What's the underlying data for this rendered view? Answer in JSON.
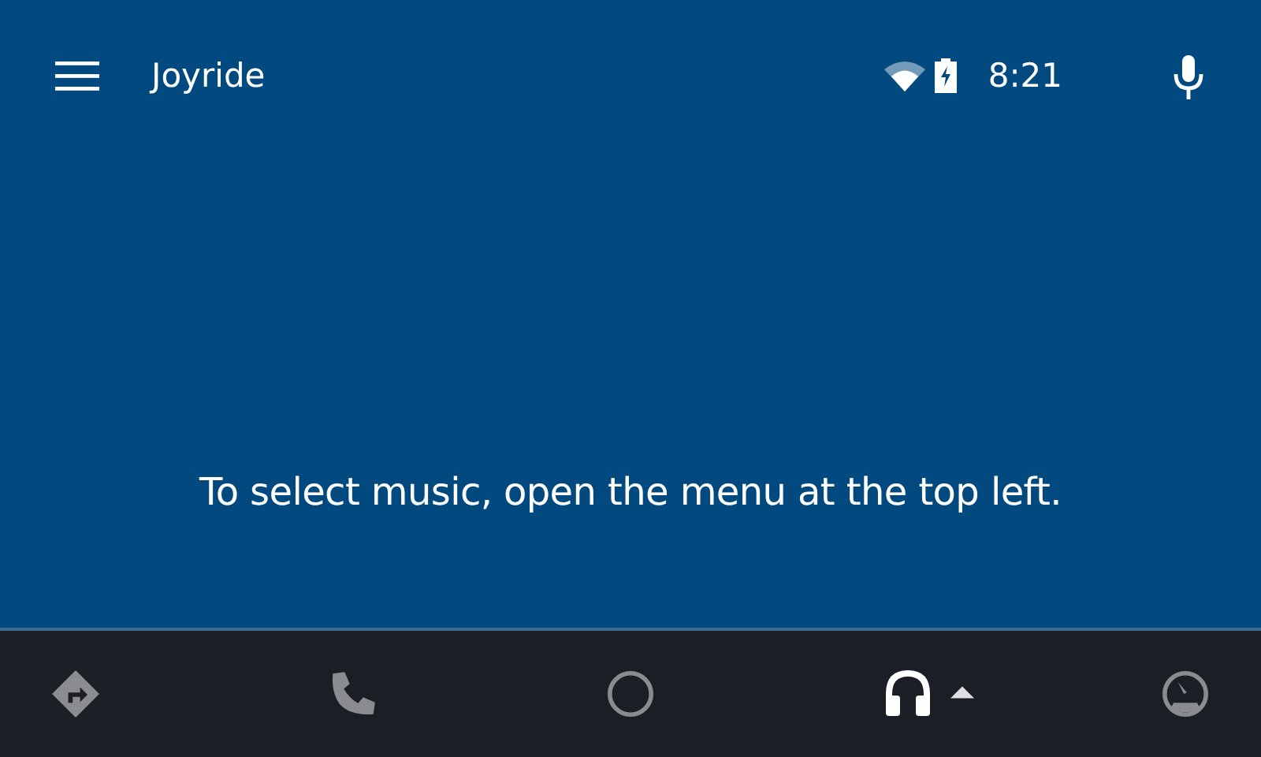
{
  "app_bar": {
    "title": "Joyride",
    "time": "8:21"
  },
  "message": "To select music, open the menu at the top left.",
  "nav_bar": [
    {
      "kind": "navigation",
      "selected": false
    },
    {
      "kind": "phone",
      "selected": false
    },
    {
      "kind": "home",
      "selected": false
    },
    {
      "kind": "music",
      "selected": true
    },
    {
      "kind": "dashboard",
      "selected": false
    }
  ]
}
